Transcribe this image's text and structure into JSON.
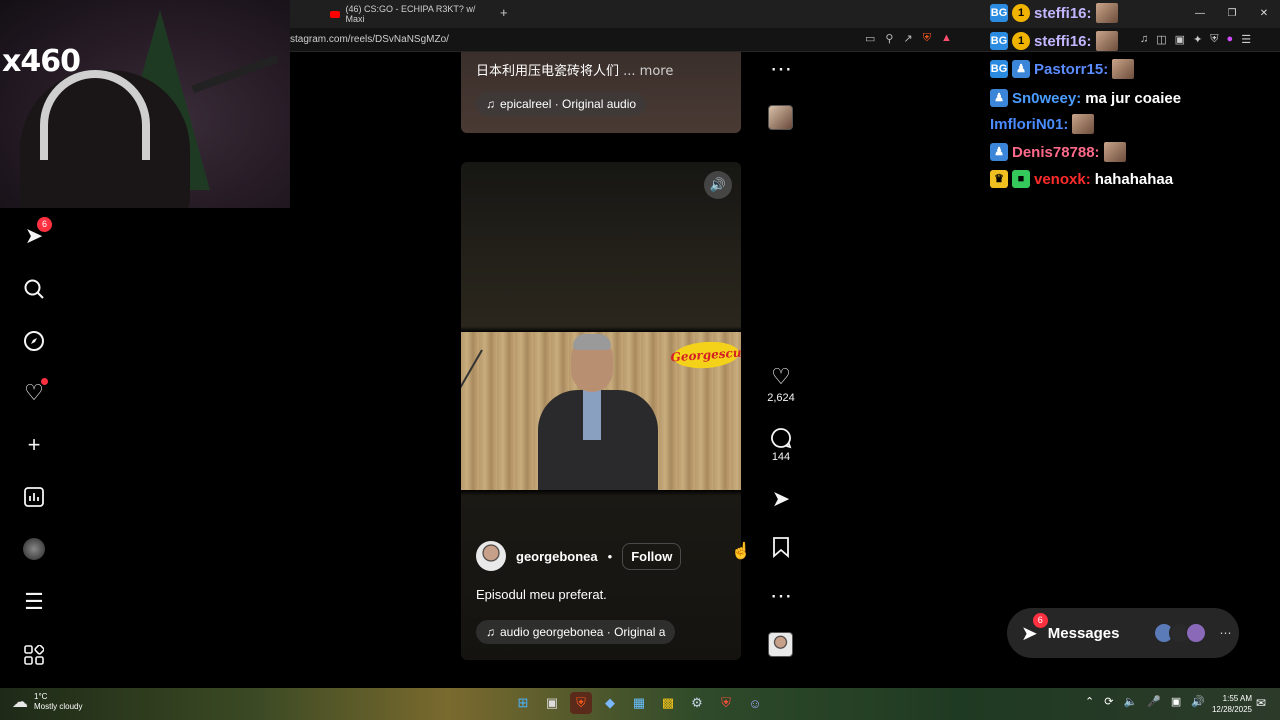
{
  "browser": {
    "tab_title": "(46) CS:GO - ECHIPA R3KT? w/ Maxi",
    "url": "stagram.com/reels/DSvNaNSgMZo/"
  },
  "stream": {
    "overlay_text": "x460"
  },
  "sidenav": {
    "messages_badge": "6"
  },
  "reel_top": {
    "caption": "日本利用压电瓷砖将人们",
    "more": "... more",
    "audio": "epicalreel · Original audio"
  },
  "reel_main": {
    "video_logo": "Georgescu",
    "author": "georgebonea",
    "follow": "Follow",
    "caption": "Episodul meu preferat.",
    "audio": "audio  georgebonea · Original a"
  },
  "actions": {
    "likes": "2,624",
    "comments": "144"
  },
  "chat": [
    {
      "user": "steffi16:",
      "color": "#c3b6ff",
      "message": "",
      "badges": [
        "bg",
        "1"
      ]
    },
    {
      "user": "steffi16:",
      "color": "#c3b6ff",
      "message": "",
      "badges": [
        "bg",
        "1"
      ]
    },
    {
      "user": "Pastorr15:",
      "color": "#5b8cff",
      "message": "",
      "badges": [
        "bg",
        "person"
      ]
    },
    {
      "user": "Sn0weey:",
      "color": "#4b9cff",
      "message": "ma jur coaiee",
      "badges": [
        "person"
      ]
    },
    {
      "user": "ImfloriN01:",
      "color": "#4b8cff",
      "message": "",
      "badges": []
    },
    {
      "user": "Denis78788:",
      "color": "#ff6a8a",
      "message": "",
      "badges": [
        "person"
      ]
    },
    {
      "user": "venoxk:",
      "color": "#ff2b2b",
      "message": "hahahahaa",
      "badges": [
        "crown",
        "gift"
      ]
    }
  ],
  "messages_pill": {
    "label": "Messages",
    "badge": "6"
  },
  "taskbar": {
    "temp": "1°C",
    "weather": "Mostly cloudy",
    "time": "1:55 AM",
    "date": "12/28/2025"
  }
}
